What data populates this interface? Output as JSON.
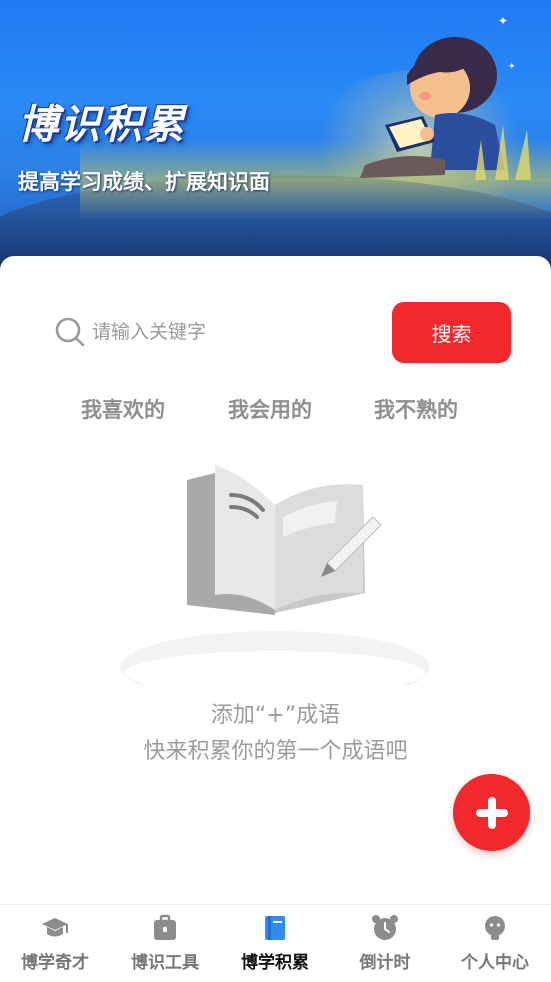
{
  "banner": {
    "title": "博识积累",
    "subtitle": "提高学习成绩、扩展知识面"
  },
  "search": {
    "placeholder": "请输入关键字",
    "button_label": "搜索"
  },
  "tabs": [
    {
      "label": "我喜欢的"
    },
    {
      "label": "我会用的"
    },
    {
      "label": "我不熟的"
    }
  ],
  "empty_state": {
    "line1": "添加“+”成语",
    "line2": "快来积累你的第一个成语吧"
  },
  "fab": {
    "icon": "plus-icon"
  },
  "bottom_nav": {
    "items": [
      {
        "label": "博学奇才",
        "icon": "graduation-cap-icon"
      },
      {
        "label": "博识工具",
        "icon": "toolbox-icon"
      },
      {
        "label": "博学积累",
        "icon": "book-icon",
        "active": true
      },
      {
        "label": "倒计时",
        "icon": "alarm-clock-icon"
      },
      {
        "label": "个人中心",
        "icon": "user-icon"
      }
    ]
  },
  "colors": {
    "accent": "#f2282c",
    "nav_active": "#2f8cf0",
    "nav_inactive": "#8c8c8c",
    "muted_text": "#9c9c9c"
  }
}
